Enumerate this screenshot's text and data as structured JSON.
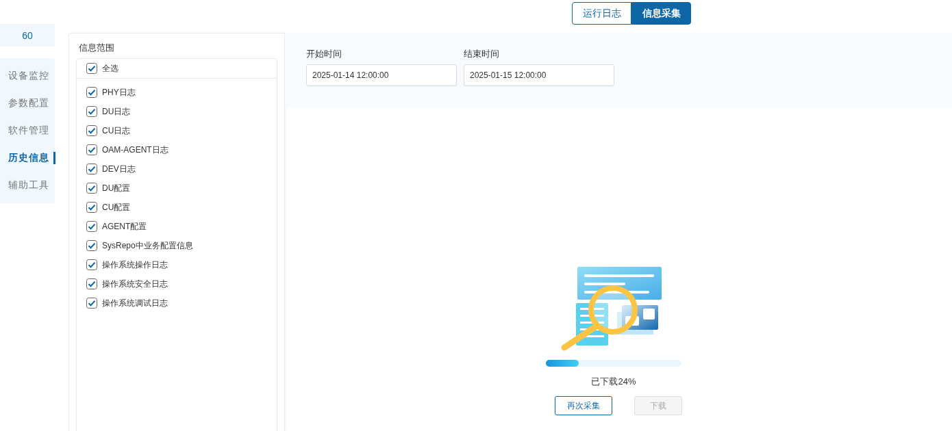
{
  "sidebar": {
    "badge": "60",
    "items": [
      {
        "label": "设备监控",
        "selected": false
      },
      {
        "label": "参数配置",
        "selected": false
      },
      {
        "label": "软件管理",
        "selected": false
      },
      {
        "label": "历史信息",
        "selected": true
      },
      {
        "label": "辅助工具",
        "selected": false
      }
    ]
  },
  "tabs": [
    {
      "label": "运行日志",
      "selected": false
    },
    {
      "label": "信息采集",
      "selected": true
    }
  ],
  "scope": {
    "title": "信息范围",
    "select_all": {
      "label": "全选",
      "checked": true
    },
    "items": [
      {
        "label": "PHY日志",
        "checked": true
      },
      {
        "label": "DU日志",
        "checked": true
      },
      {
        "label": "CU日志",
        "checked": true
      },
      {
        "label": "OAM-AGENT日志",
        "checked": true
      },
      {
        "label": "DEV日志",
        "checked": true
      },
      {
        "label": "DU配置",
        "checked": true
      },
      {
        "label": "CU配置",
        "checked": true
      },
      {
        "label": "AGENT配置",
        "checked": true
      },
      {
        "label": "SysRepo中业务配置信息",
        "checked": true
      },
      {
        "label": "操作系统操作日志",
        "checked": true
      },
      {
        "label": "操作系统安全日志",
        "checked": true
      },
      {
        "label": "操作系统调试日志",
        "checked": true
      }
    ]
  },
  "time": {
    "start": {
      "label": "开始时间",
      "value": "2025-01-14 12:00:00"
    },
    "end": {
      "label": "结束时间",
      "value": "2025-01-15 12:00:00"
    }
  },
  "progress": {
    "level": 0.24,
    "text": "已下载24%"
  },
  "buttons": [
    {
      "label": "再次采集",
      "disabled": false
    },
    {
      "label": "下载",
      "disabled": true
    }
  ]
}
